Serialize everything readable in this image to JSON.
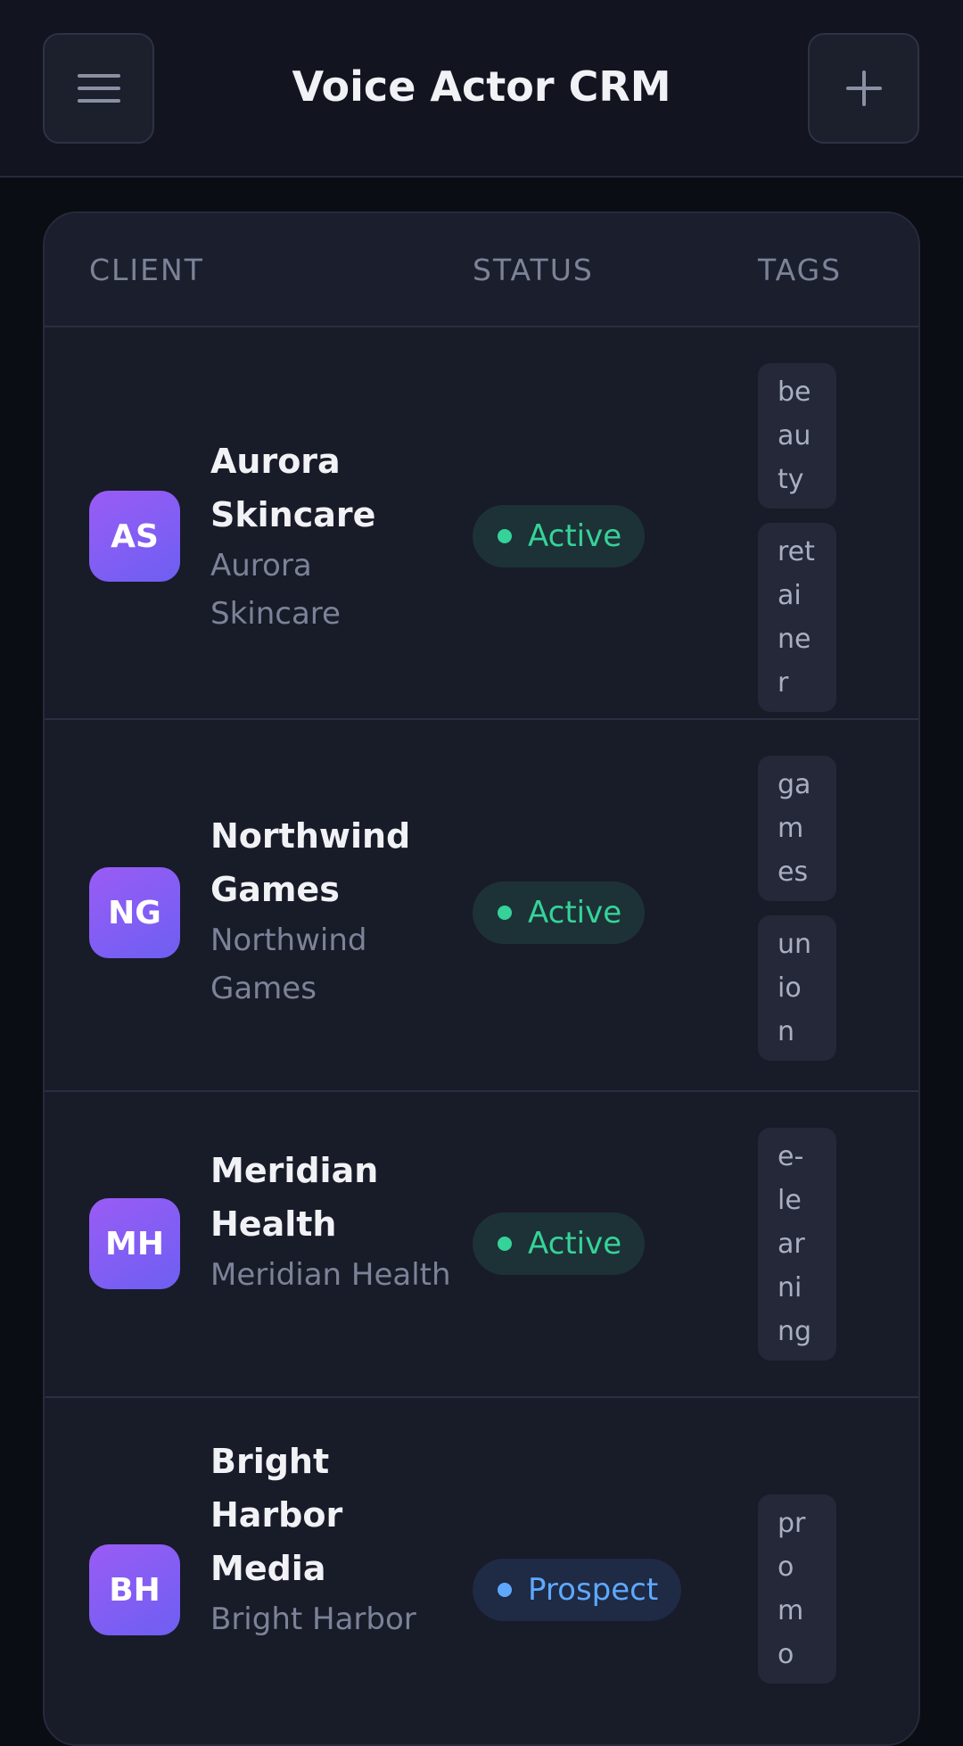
{
  "header": {
    "title": "Voice Actor CRM",
    "menu_icon": "menu-icon",
    "add_icon": "plus-icon"
  },
  "table": {
    "columns": [
      "CLIENT",
      "STATUS",
      "TAGS"
    ],
    "rows": [
      {
        "initials": "AS",
        "name": "Aurora Skincare",
        "company": "Aurora Skincare",
        "status": "Active",
        "tags": [
          "be\nau\nty",
          "ret\nai\nne\nr"
        ]
      },
      {
        "initials": "NG",
        "name": "Northwind Games",
        "company": "Northwind Games",
        "status": "Active",
        "tags": [
          "ga\nm\nes",
          "un\nio\nn"
        ]
      },
      {
        "initials": "MH",
        "name": "Meridian Health",
        "company": "Meridian Health",
        "status": "Active",
        "tags": [
          "e-\nle\nar\nni\nng"
        ]
      },
      {
        "initials": "BH",
        "name": "Bright Harbor Media",
        "company": "Bright Harbor",
        "status": "Prospect",
        "tags": [
          "pr\no\nm\no"
        ]
      }
    ]
  },
  "colors": {
    "active": "#35d399",
    "prospect": "#5ea9ff",
    "avatar_gradient_start": "#9a5cf5",
    "avatar_gradient_end": "#6d5ff2"
  }
}
